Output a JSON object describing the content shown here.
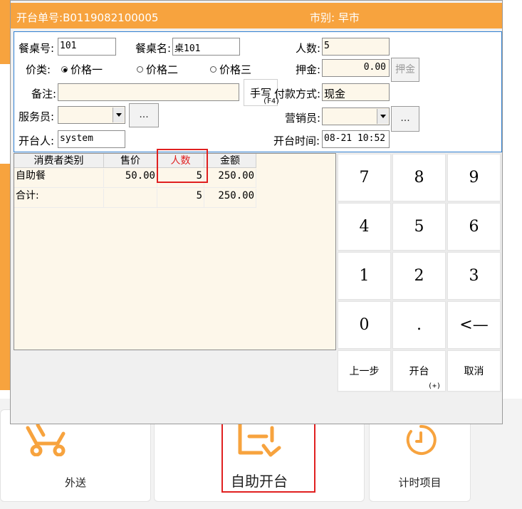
{
  "dialog": {
    "order_label": "开台单号:",
    "order_no": "B0119082100005",
    "market_label": "市别:",
    "market": "早市"
  },
  "form": {
    "table_no_label": "餐桌号:",
    "table_no": "101",
    "table_name_label": "餐桌名:",
    "table_name": "桌101",
    "people_label": "人数:",
    "people": "5",
    "price_type_label": "价类:",
    "price_options": [
      "价格一",
      "价格二",
      "价格三"
    ],
    "price_selected": "价格一",
    "deposit_label": "押金:",
    "deposit": "0.00",
    "deposit_button": "押金",
    "note_label": "备注:",
    "note": "",
    "handwrite_label": "手写",
    "handwrite_key": "(F4)",
    "payment_label": "付款方式:",
    "payment": "现金",
    "waiter_label": "服务员:",
    "waiter": "",
    "marketer_label": "营销员:",
    "marketer": "",
    "more_button": "...",
    "opener_label": "开台人:",
    "opener": "system",
    "open_time_label": "开台时间:",
    "open_time": "08-21 10:52"
  },
  "grid": {
    "headers": [
      "消费者类别",
      "售价",
      "人数",
      "金额"
    ],
    "rows": [
      {
        "type": "自助餐",
        "price": "50.00",
        "count": "5",
        "amount": "250.00"
      }
    ],
    "total": {
      "label": "合计:",
      "price": "",
      "count": "5",
      "amount": "250.00"
    }
  },
  "keypad": {
    "keys": [
      "7",
      "8",
      "9",
      "4",
      "5",
      "6",
      "1",
      "2",
      "3",
      "0",
      ".",
      "<—"
    ],
    "prev_label": "上一步",
    "open_label": "开台",
    "open_key": "(+)",
    "cancel_label": "取消"
  },
  "background": {
    "cards": [
      "外送",
      "自助开台",
      "计时项目"
    ],
    "accent_color": "#f7a33e",
    "highlight_color": "#e02020"
  }
}
